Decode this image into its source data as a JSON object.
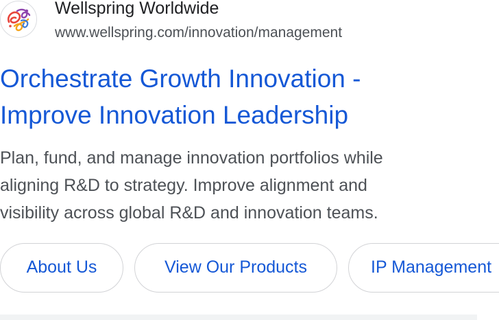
{
  "site": {
    "name": "Wellspring Worldwide",
    "url": "www.wellspring.com/innovation/management",
    "favicon": "wellspring-logo-icon"
  },
  "headline": {
    "line1": "Orchestrate Growth Innovation -",
    "line2": "Improve Innovation Leadership"
  },
  "description": {
    "line1": "Plan, fund, and manage innovation portfolios while",
    "line2": "aligning R&D to strategy. Improve alignment and",
    "line3": "visibility across global R&D and innovation teams."
  },
  "sitelinks": [
    {
      "label": "About Us"
    },
    {
      "label": "View Our Products"
    },
    {
      "label": "IP Management"
    }
  ],
  "colors": {
    "link": "#1558d6",
    "text": "#4d5156",
    "title": "#202124",
    "chip_border": "#d2d3d6"
  }
}
